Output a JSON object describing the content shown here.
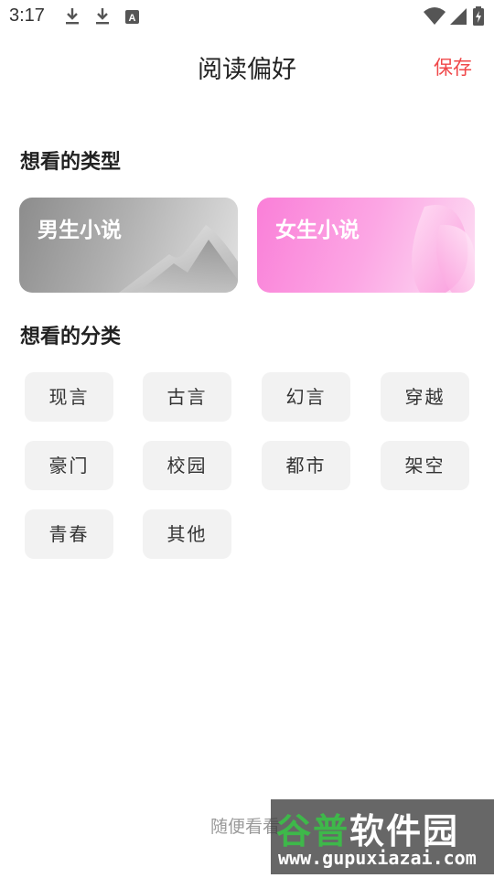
{
  "status_bar": {
    "time": "3:17",
    "icons": [
      "download-icon",
      "download-icon",
      "text-a-icon",
      "wifi-icon",
      "signal-icon",
      "battery-charging-icon"
    ]
  },
  "header": {
    "title": "阅读偏好",
    "save_label": "保存",
    "save_color": "#f0484a"
  },
  "sections": {
    "types_title": "想看的类型",
    "categories_title": "想看的分类"
  },
  "gender_cards": [
    {
      "label": "男生小说"
    },
    {
      "label": "女生小说"
    }
  ],
  "categories": [
    "现言",
    "古言",
    "幻言",
    "穿越",
    "豪门",
    "校园",
    "都市",
    "架空",
    "青春",
    "其他"
  ],
  "footer": {
    "link_text": "随便看看"
  },
  "watermark": {
    "title_part1": "谷普",
    "title_part2": "软件园",
    "url": "www.gupuxiazai.com"
  }
}
